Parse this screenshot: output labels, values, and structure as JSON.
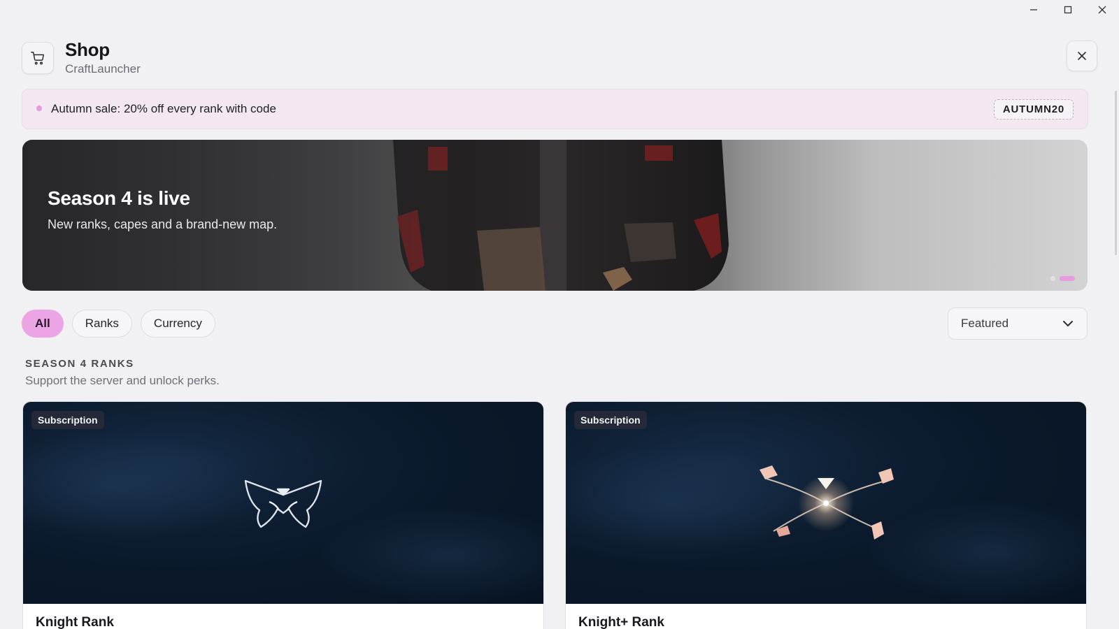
{
  "window": {
    "controls": [
      "minimize-icon",
      "maximize-icon",
      "close-icon"
    ]
  },
  "header": {
    "icon": "cart-icon",
    "title": "Shop",
    "subtitle": "CraftLauncher",
    "close_icon": "close-icon"
  },
  "promo": {
    "text": "Autumn sale: 20% off every rank with code",
    "code": "AUTUMN20",
    "dot_color": "#e79ae0"
  },
  "hero": {
    "title": "Season 4 is live",
    "subtitle": "New ranks, capes and a brand-new map.",
    "slides": 2,
    "active_slide": 2
  },
  "filters": {
    "chips": [
      {
        "label": "All",
        "active": true
      },
      {
        "label": "Ranks",
        "active": false
      },
      {
        "label": "Currency",
        "active": false
      }
    ],
    "sort": {
      "selected": "Featured",
      "icon": "chevron-down-icon"
    }
  },
  "section": {
    "heading": "SEASON 4 RANKS",
    "description": "Support the server and unlock perks."
  },
  "cards": [
    {
      "badge": "Subscription",
      "name": "Knight Rank"
    },
    {
      "badge": "Subscription",
      "name": "Knight+ Rank"
    }
  ],
  "colors": {
    "accent": "#eba4e4",
    "background": "#f1f1f4",
    "card_media": "#0b1a2c"
  }
}
